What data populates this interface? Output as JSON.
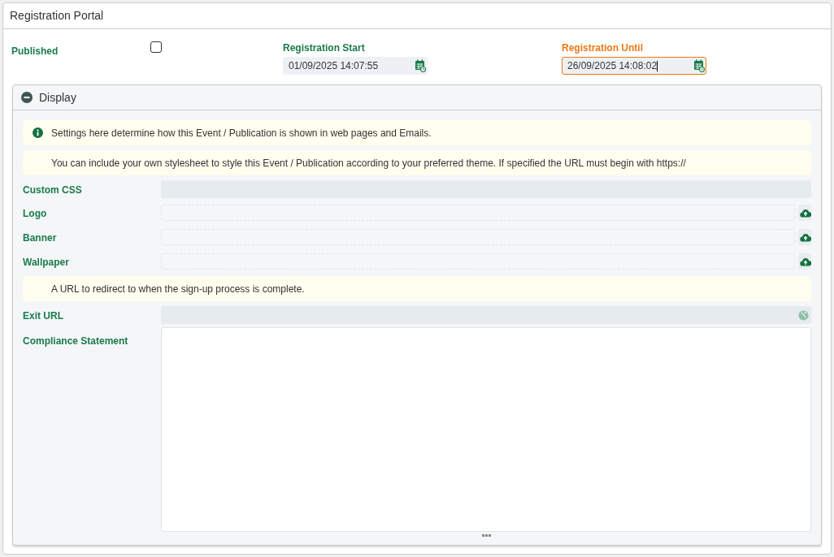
{
  "window": {
    "title": "Registration Portal"
  },
  "published": {
    "label": "Published",
    "checked": false
  },
  "date_fields": [
    {
      "label": "Registration Start",
      "value": "01/09/2025 14:07:55",
      "focused": false
    },
    {
      "label": "Registration Until",
      "value": "26/09/2025 14:08:02",
      "focused": true
    }
  ],
  "section": {
    "title": "Display",
    "expanded": true,
    "items": [
      {
        "kind": "note",
        "info": true,
        "text": "Settings here determine how this Event / Publication is shown in web pages and Emails."
      },
      {
        "kind": "note",
        "info": false,
        "text": "You can include your own stylesheet to style this Event / Publication according to your preferred theme. If specified the URL must begin with https://"
      },
      {
        "kind": "text",
        "label": "Custom CSS"
      },
      {
        "kind": "upload",
        "label": "Logo"
      },
      {
        "kind": "upload",
        "label": "Banner"
      },
      {
        "kind": "upload",
        "label": "Wallpaper"
      },
      {
        "kind": "note",
        "info": false,
        "text": "A URL to redirect to when the sign-up process is complete."
      },
      {
        "kind": "url",
        "label": "Exit URL"
      },
      {
        "kind": "textarea",
        "label": "Compliance Statement"
      }
    ]
  }
}
